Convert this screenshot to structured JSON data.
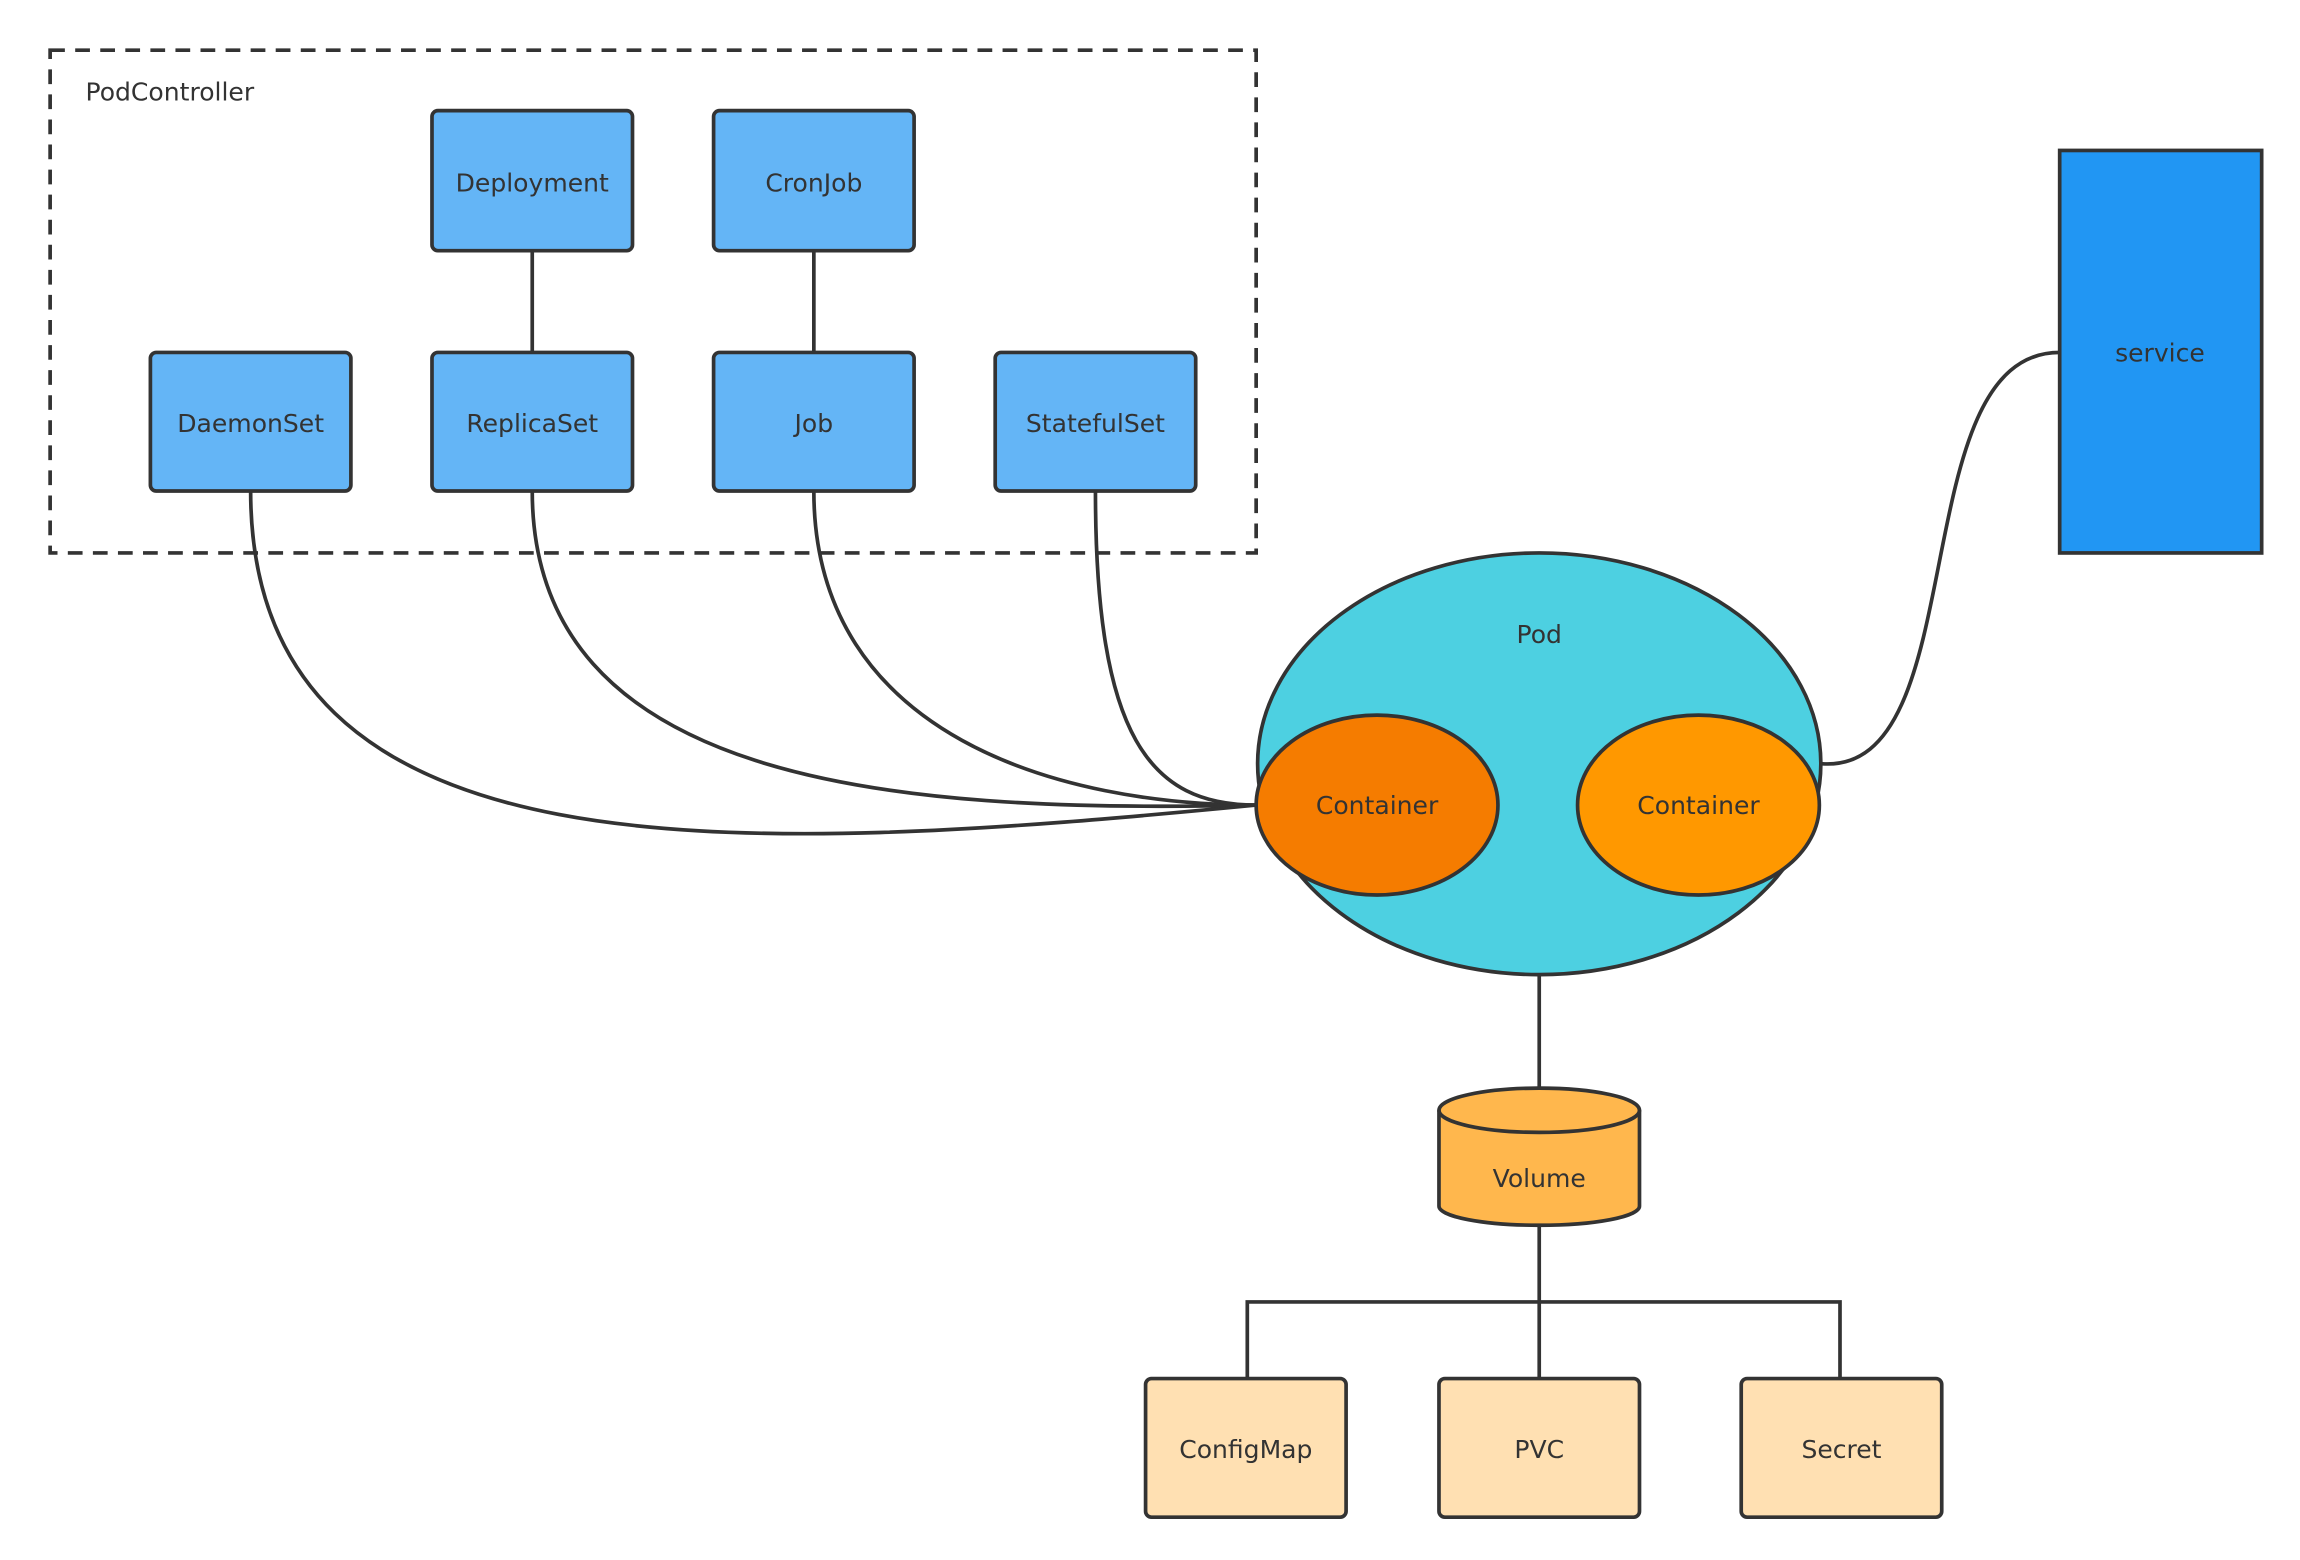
{
  "group": {
    "label": "PodController"
  },
  "controllers": {
    "deployment": "Deployment",
    "cronjob": "CronJob",
    "daemonset": "DaemonSet",
    "replicaset": "ReplicaSet",
    "job": "Job",
    "statefulset": "StatefulSet"
  },
  "service": {
    "label": "service"
  },
  "pod": {
    "label": "Pod",
    "container1": "Container",
    "container2": "Container"
  },
  "volume": {
    "label": "Volume"
  },
  "sources": {
    "configmap": "ConfigMap",
    "pvc": "PVC",
    "secret": "Secret"
  },
  "colors": {
    "controller": "#64B5F6",
    "service": "#2196F3",
    "pod": "#4DD0E1",
    "container1": "#F57C00",
    "container2": "#FF9800",
    "volume": "#FFB74D",
    "source": "#FFE0B2",
    "stroke": "#333333"
  }
}
